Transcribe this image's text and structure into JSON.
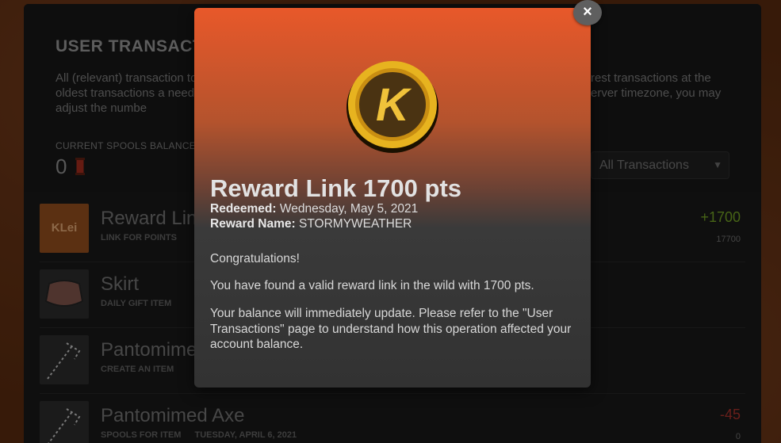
{
  "page": {
    "title": "USER TRANSACT",
    "description_left": "All (relevant) transaction top, oldest transactions a need to adjust the numbe",
    "description_right": "rest transactions at the erver timezone, you may",
    "balance_label": "CURRENT SPOOLS BALANCE",
    "balance_value": "0",
    "filter_selected": "All Transactions"
  },
  "rows": [
    {
      "title": "Reward Lin",
      "subtitle": "LINK FOR POINTS",
      "amount": "+1700",
      "balance": "17700",
      "thumb_text": "KLei",
      "amount_color": "#6d9a23"
    },
    {
      "title": "Skirt",
      "subtitle": "DAILY GIFT ITEM",
      "amount": "",
      "balance": ""
    },
    {
      "title": "Pantomime",
      "subtitle": "CREATE AN ITEM",
      "amount": "",
      "balance": ""
    },
    {
      "title": "Pantomimed Axe",
      "subtitle": "SPOOLS FOR ITEM",
      "date": "TUESDAY, APRIL 6, 2021",
      "amount": "-45",
      "balance": "0",
      "amount_color": "#a0302a"
    }
  ],
  "modal": {
    "title": "Reward Link 1700 pts",
    "redeemed_label": "Redeemed:",
    "redeemed_value": "Wednesday, May 5, 2021",
    "reward_name_label": "Reward Name:",
    "reward_name_value": "STORMYWEATHER",
    "paragraph_1": "Congratulations!",
    "paragraph_2": "You have found a valid reward link in the wild with 1700 pts.",
    "paragraph_3": "Your balance will immediately update. Please refer to the \"User Transactions\" page to understand how this operation affected your account balance.",
    "close_label": "×",
    "coin_letter": "K"
  },
  "colors": {
    "modal_top": "#e8582a",
    "modal_bottom": "#323232",
    "coin_gold": "#e7b31f",
    "positive": "#6d9a23",
    "negative": "#a0302a"
  }
}
